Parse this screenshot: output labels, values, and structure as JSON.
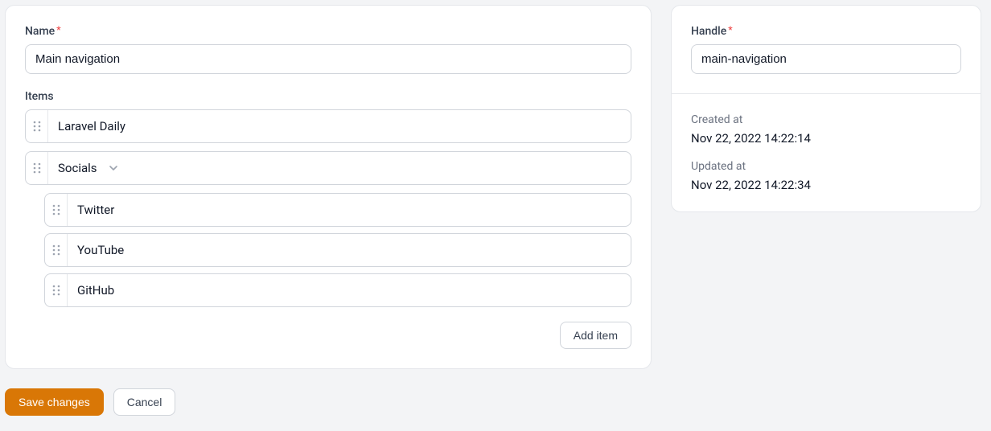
{
  "form": {
    "name_label": "Name",
    "name_value": "Main navigation",
    "items_label": "Items",
    "items": [
      {
        "label": "Laravel Daily",
        "children": []
      },
      {
        "label": "Socials",
        "expandable": true,
        "children": [
          {
            "label": "Twitter"
          },
          {
            "label": "YouTube"
          },
          {
            "label": "GitHub"
          }
        ]
      }
    ],
    "add_item_label": "Add item"
  },
  "sidebar": {
    "handle_label": "Handle",
    "handle_value": "main-navigation",
    "created_label": "Created at",
    "created_value": "Nov 22, 2022 14:22:14",
    "updated_label": "Updated at",
    "updated_value": "Nov 22, 2022 14:22:34"
  },
  "actions": {
    "save_label": "Save changes",
    "cancel_label": "Cancel"
  },
  "colors": {
    "primary": "#d97706"
  }
}
